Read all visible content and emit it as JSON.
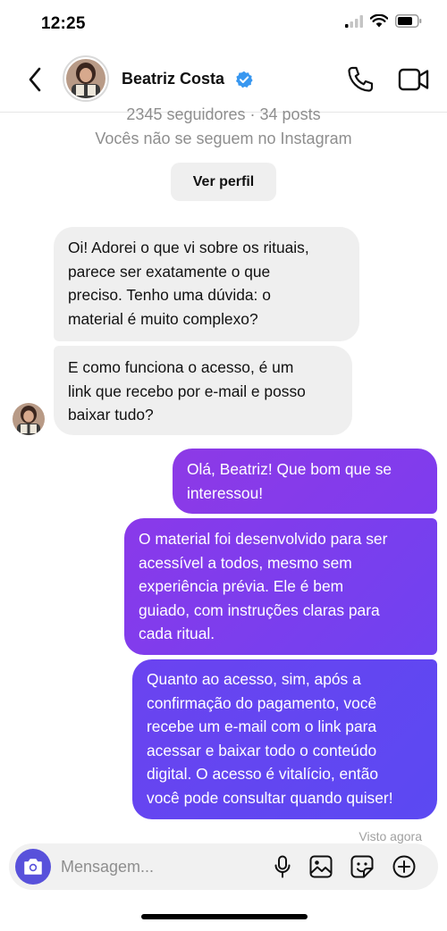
{
  "status_bar": {
    "time": "12:25"
  },
  "header": {
    "name": "Beatriz Costa",
    "verified": true
  },
  "profile": {
    "stats": "2345 seguidores · 34 posts",
    "follow_note": "Vocês não se seguem no Instagram",
    "view_profile_label": "Ver perfil"
  },
  "messages": [
    {
      "from": "them",
      "text": "Oi! Adorei o que vi sobre os rituais, parece ser exatamente o que preciso. Tenho uma dúvida: o material é muito complexo?",
      "lines": [
        "Oi! Adorei o que vi sobre os rituais,",
        "parece ser exatamente o que",
        "preciso. Tenho uma dúvida: o",
        "material é muito complexo?"
      ]
    },
    {
      "from": "them",
      "text": "E como funciona o acesso, é um link que recebo por e-mail e posso baixar tudo?",
      "lines": [
        "E como funciona o acesso, é um",
        "link que recebo por e-mail e posso",
        "baixar tudo?"
      ]
    },
    {
      "from": "me",
      "text": "Olá, Beatriz! Que bom que se interessou!",
      "lines": [
        "Olá, Beatriz! Que bom que se",
        "interessou!"
      ]
    },
    {
      "from": "me",
      "text": "O material foi desenvolvido para ser acessível a todos, mesmo sem experiência prévia. Ele é bem guiado, com instruções claras para cada ritual.",
      "lines": [
        "O material foi desenvolvido para ser",
        "acessível a todos, mesmo sem",
        "experiência prévia. Ele é bem",
        "guiado, com instruções claras para",
        "cada ritual."
      ]
    },
    {
      "from": "me",
      "text": "Quanto ao acesso, sim, após a confirmação do pagamento, você recebe um e-mail com o link para acessar e baixar todo o conteúdo digital. O acesso é vitalício, então você pode consultar quando quiser!",
      "lines": [
        "Quanto ao acesso, sim, após a",
        "confirmação do pagamento, você",
        "recebe um e-mail com o link para",
        "acessar e baixar todo o conteúdo",
        "digital. O acesso é vitalício, então",
        "você pode consultar quando quiser!"
      ]
    }
  ],
  "seen_label": "Visto agora",
  "composer": {
    "placeholder": "Mensagem..."
  },
  "colors": {
    "accent": "#5851db",
    "verified": "#3897f0",
    "outgoing_start": "#8d3ae6",
    "outgoing_end": "#5b49f2"
  },
  "icons": [
    "back-arrow-icon",
    "verified-badge-icon",
    "phone-icon",
    "video-camera-icon",
    "camera-icon",
    "microphone-icon",
    "image-icon",
    "sticker-icon",
    "plus-circle-icon"
  ]
}
